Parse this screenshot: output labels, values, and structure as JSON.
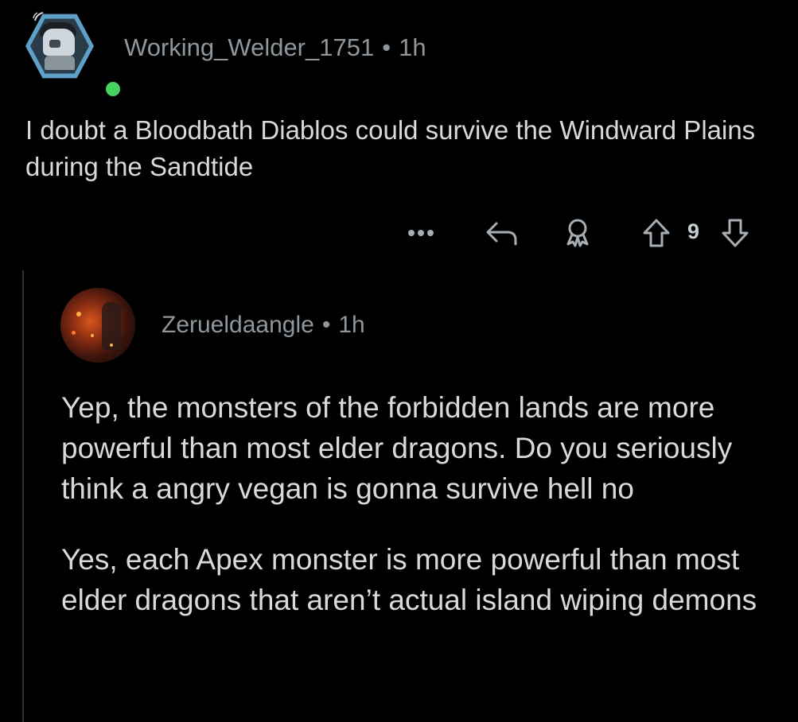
{
  "parent_comment": {
    "avatar_icon": "robot-snoo-avatar-icon",
    "online_status_color": "#46d160",
    "username": "Working_Welder_1751",
    "separator": "•",
    "timestamp": "1h",
    "text": "I doubt a Bloodbath Diablos could survive the Windward Plains during the Sandtide",
    "actions": {
      "more_icon": "more-options-icon",
      "reply_icon": "reply-icon",
      "award_icon": "award-icon",
      "upvote_icon": "upvote-icon",
      "vote_count": "9",
      "downvote_icon": "downvote-icon"
    }
  },
  "reply_comment": {
    "avatar_icon": "fire-figure-avatar-icon",
    "username": "Zerueldaangle",
    "separator": "•",
    "timestamp": "1h",
    "paragraphs": [
      "Yep, the monsters of the forbidden lands are more powerful than most elder dragons. Do you seriously think a angry vegan is gonna survive hell no",
      "Yes, each Apex monster is more powerful than most elder dragons that aren’t actual island wiping demons"
    ]
  },
  "colors": {
    "background": "#000000",
    "text": "#d7dadc",
    "meta_text": "#8f969c",
    "icon": "#a6adb3",
    "thread_line": "#2f3336"
  }
}
